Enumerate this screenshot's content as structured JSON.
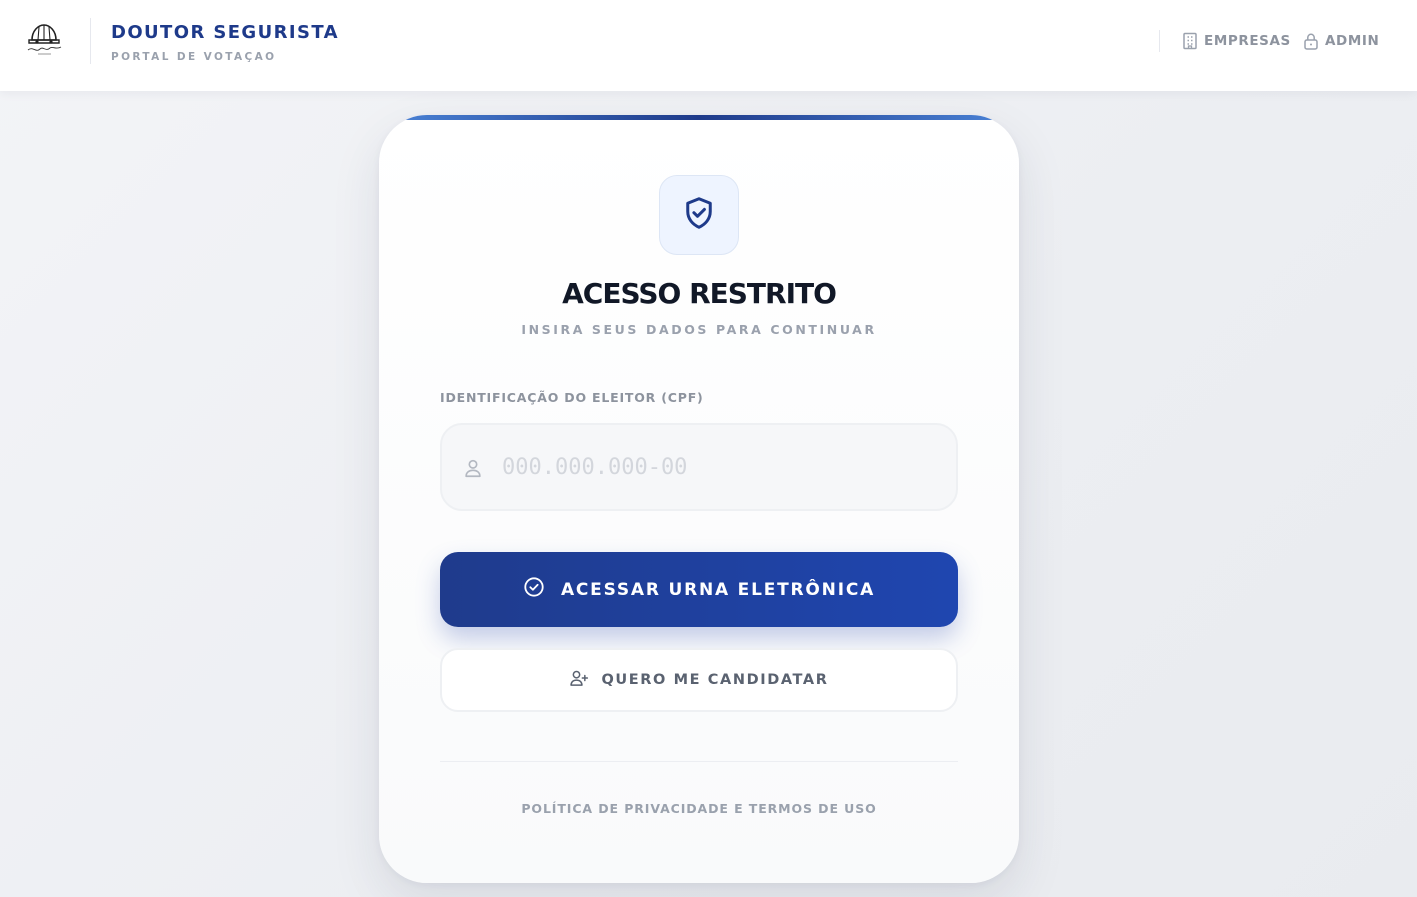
{
  "header": {
    "logo": "helmet-logo",
    "title": "DOUTOR SEGURISTA",
    "subtitle": "PORTAL DE VOTAÇAO",
    "nav": [
      {
        "label": "EMPRESAS",
        "icon": "building-icon"
      },
      {
        "label": "ADMIN",
        "icon": "lock-icon"
      }
    ]
  },
  "card": {
    "icon": "shield-check-icon",
    "title": "ACESSO RESTRITO",
    "subtitle": "INSIRA SEUS DADOS PARA CONTINUAR",
    "cpf_label": "IDENTIFICAÇÃO DO ELEITOR (CPF)",
    "cpf_placeholder": "000.000.000-00",
    "cpf_value": "",
    "primary_button": "ACESSAR URNA ELETRÔNICA",
    "secondary_button": "QUERO ME CANDIDATAR",
    "footer_link": "POLÍTICA DE PRIVACIDADE E TERMOS DE USO"
  },
  "colors": {
    "brand": "#1e3a8a",
    "primary_button": "#1f46b0",
    "muted_text": "#9aa1ad",
    "background": "#eef0f4"
  }
}
